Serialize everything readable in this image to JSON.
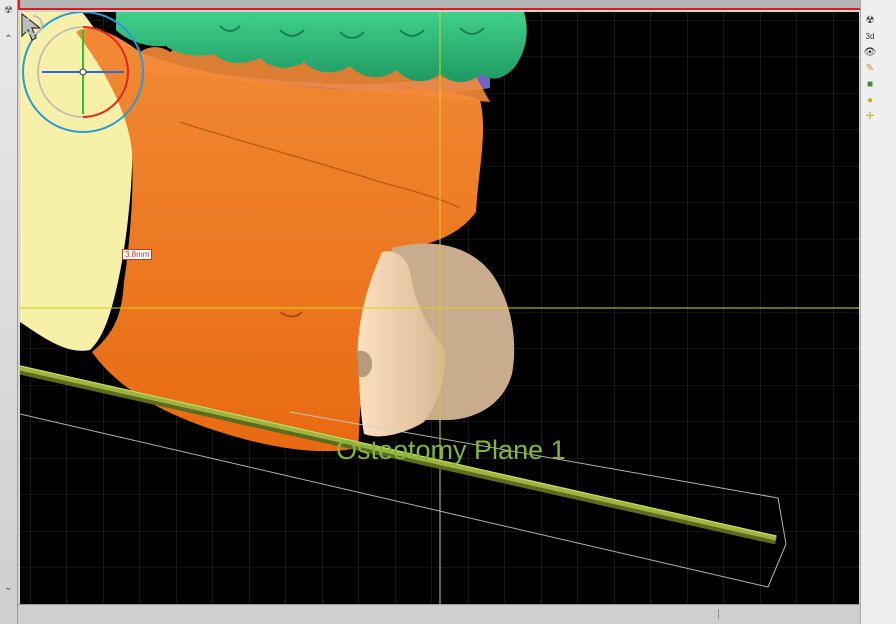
{
  "viewport": {
    "measurement_label": "3.8mm",
    "plane_label": "Osteotomy Plane 1"
  },
  "colors": {
    "background": "#000000",
    "grid": "#8a8a8a",
    "frame_accent": "#e01b1b",
    "mandible": "#f07a23",
    "teeth": "#2fb87a",
    "gum": "#6f63c8",
    "skin": "#f6f0a8",
    "bone_cut": "#fbe0bf",
    "bone_shadow": "#c9ab8e",
    "plane": "#93a83b",
    "plane_label": "#7fb83f",
    "crosshair": "#d7d21b",
    "gizmo_ring": "#2a9ad8",
    "gizmo_red": "#e2251f",
    "gizmo_green": "#2cc32c",
    "gizmo_blue": "#2f65e0"
  },
  "icons": {
    "left_strip": [
      "radiation-icon",
      "chevron-up-icon",
      "chevron-down-icon"
    ],
    "right_toolbar": [
      "radiation-icon",
      "view-3d-icon",
      "eye-icon",
      "paint-icon",
      "cube-icon",
      "sphere-icon",
      "axes-icon"
    ],
    "cursor": "pointer-arrow-icon",
    "rotate": "rotate-icon"
  }
}
